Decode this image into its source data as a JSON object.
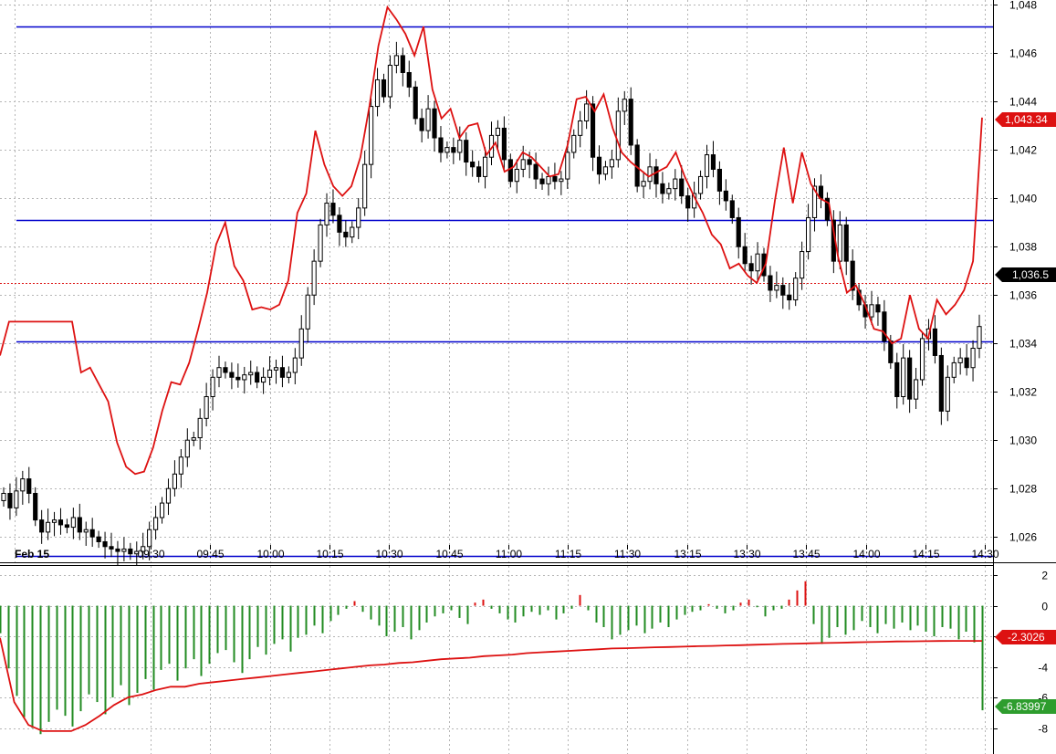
{
  "chart_data": [
    {
      "type": "candlestick",
      "date_label": "Feb 15",
      "x_ticks": [
        "09:30",
        "09:45",
        "10:00",
        "10:15",
        "10:30",
        "10:45",
        "11:00",
        "11:15",
        "11:30",
        "13:15",
        "13:30",
        "13:45",
        "14:00",
        "14:15",
        "14:30"
      ],
      "y_ticks": [
        "1,048",
        "1,046",
        "1,044",
        "1,042",
        "1,040",
        "1,038",
        "1,036",
        "1,034",
        "1,032",
        "1,030",
        "1,028",
        "1,026"
      ],
      "ylim": [
        1024.95,
        1048.2
      ],
      "grid": true,
      "horizontal_lines": [
        1047.1,
        1039.1,
        1034.1,
        1025.2
      ],
      "current_price": 1036.5,
      "current_price_label": "1,036.5",
      "red_line_last_label": "1,043.34",
      "red_line_last_value": 1043.34,
      "colors": {
        "candle": "#000000",
        "red_line": "#dd1111",
        "levels": "#0000cc",
        "badge_black": "#000000",
        "badge_red": "#dd1111"
      },
      "close_series": [
        1027.8,
        1027.2,
        1027.9,
        1028.4,
        1027.8,
        1026.7,
        1026.2,
        1026.6,
        1026.7,
        1026.5,
        1026.4,
        1026.8,
        1026.2,
        1026.3,
        1026.0,
        1025.8,
        1025.6,
        1025.5,
        1025.4,
        1025.5,
        1025.3,
        1025.4,
        1025.6,
        1026.3,
        1026.8,
        1027.4,
        1028.0,
        1028.6,
        1029.3,
        1030.0,
        1030.1,
        1030.9,
        1031.8,
        1032.6,
        1033.0,
        1032.8,
        1032.6,
        1032.5,
        1032.7,
        1032.8,
        1032.4,
        1032.6,
        1032.9,
        1033.0,
        1032.6,
        1032.8,
        1033.4,
        1034.6,
        1036.0,
        1037.4,
        1038.9,
        1039.8,
        1039.3,
        1038.6,
        1038.4,
        1038.8,
        1039.6,
        1041.4,
        1043.8,
        1044.9,
        1044.2,
        1045.5,
        1045.9,
        1045.2,
        1044.6,
        1043.3,
        1042.8,
        1043.7,
        1042.5,
        1041.9,
        1042.1,
        1041.9,
        1042.4,
        1041.5,
        1041.3,
        1040.9,
        1041.7,
        1042.6,
        1042.9,
        1041.6,
        1040.7,
        1041.2,
        1041.6,
        1041.4,
        1040.8,
        1040.6,
        1040.9,
        1040.7,
        1040.8,
        1041.9,
        1042.6,
        1043.2,
        1043.9,
        1041.7,
        1041.0,
        1041.3,
        1041.6,
        1043.6,
        1044.1,
        1042.2,
        1040.5,
        1040.7,
        1041.3,
        1040.6,
        1040.2,
        1040.4,
        1040.8,
        1040.1,
        1039.6,
        1040.2,
        1040.9,
        1041.8,
        1041.2,
        1040.3,
        1039.9,
        1039.2,
        1038.0,
        1037.3,
        1037.0,
        1037.7,
        1036.8,
        1036.2,
        1036.4,
        1036.0,
        1035.8,
        1036.7,
        1037.8,
        1039.2,
        1040.5,
        1040.0,
        1039.1,
        1037.4,
        1038.9,
        1037.4,
        1036.2,
        1035.6,
        1035.1,
        1035.6,
        1035.3,
        1034.1,
        1033.2,
        1031.8,
        1033.4,
        1031.7,
        1032.5,
        1034.2,
        1034.6,
        1033.5,
        1031.2,
        1032.6,
        1033.2,
        1033.4,
        1033.0,
        1033.8,
        1034.7
      ],
      "red_line_series": [
        1033.5,
        1034.9,
        1034.9,
        1034.9,
        1034.9,
        1034.9,
        1034.9,
        1034.9,
        1034.9,
        1032.8,
        1033.0,
        1032.3,
        1031.6,
        1029.9,
        1028.9,
        1028.6,
        1028.7,
        1029.7,
        1031.2,
        1032.4,
        1032.3,
        1033.2,
        1034.6,
        1036.1,
        1038.1,
        1039.0,
        1037.2,
        1036.6,
        1035.4,
        1035.5,
        1035.4,
        1035.6,
        1036.6,
        1039.4,
        1040.2,
        1042.8,
        1041.4,
        1040.5,
        1040.1,
        1040.5,
        1041.7,
        1043.8,
        1046.3,
        1047.9,
        1047.4,
        1046.8,
        1045.9,
        1047.1,
        1044.5,
        1043.3,
        1043.7,
        1042.5,
        1043.0,
        1043.1,
        1041.8,
        1042.3,
        1041.1,
        1041.3,
        1041.9,
        1041.7,
        1041.3,
        1040.9,
        1041.0,
        1042.2,
        1044.1,
        1044.2,
        1043.6,
        1044.3,
        1042.9,
        1041.9,
        1041.5,
        1041.2,
        1040.9,
        1041.1,
        1041.3,
        1041.9,
        1040.9,
        1040.1,
        1039.4,
        1038.5,
        1038.1,
        1037.1,
        1037.3,
        1036.8,
        1036.5,
        1037.3,
        1039.9,
        1042.1,
        1039.8,
        1041.9,
        1040.6,
        1040.0,
        1039.8,
        1037.6,
        1036.1,
        1036.4,
        1035.6,
        1034.6,
        1034.5,
        1034.0,
        1034.2,
        1036.0,
        1034.6,
        1034.2,
        1035.8,
        1035.2,
        1035.6,
        1036.2,
        1037.4,
        1043.34
      ]
    },
    {
      "type": "bar",
      "y_ticks": [
        "2",
        "0",
        "-2",
        "-4",
        "-6",
        "-8"
      ],
      "ylim": [
        -9.7,
        2.6
      ],
      "grid": true,
      "last_value_red_label": "-2.3026",
      "last_value_green_label": "-6.83997",
      "colors": {
        "positive": "#dd1111",
        "negative": "#228B22",
        "signal": "#dd1111"
      },
      "histogram": [
        -1.8,
        -4.1,
        -5.9,
        -7.3,
        -8.0,
        -8.4,
        -7.6,
        -6.8,
        -7.2,
        -7.9,
        -6.9,
        -5.8,
        -6.3,
        -7.1,
        -6.0,
        -5.2,
        -6.5,
        -5.7,
        -4.8,
        -5.5,
        -4.2,
        -3.8,
        -4.9,
        -4.1,
        -3.5,
        -4.6,
        -3.8,
        -3.1,
        -2.9,
        -3.7,
        -4.4,
        -3.5,
        -2.7,
        -3.2,
        -2.5,
        -2.2,
        -3.0,
        -2.1,
        -1.9,
        -1.3,
        -1.8,
        -1.0,
        -0.6,
        -0.2,
        0.3,
        -0.4,
        -0.9,
        -1.3,
        -2.0,
        -1.7,
        -1.4,
        -2.2,
        -1.6,
        -1.1,
        -0.7,
        -0.5,
        -0.3,
        -0.8,
        -1.2,
        0.2,
        0.4,
        -0.2,
        -0.5,
        -0.9,
        -1.1,
        -0.7,
        -0.4,
        -0.6,
        -0.3,
        -0.9,
        -0.5,
        -0.2,
        0.7,
        -0.3,
        -1.1,
        -1.4,
        -2.2,
        -1.9,
        -1.6,
        -1.3,
        -1.8,
        -1.5,
        -1.1,
        -1.4,
        -0.9,
        -0.6,
        -0.4,
        -0.3,
        0.1,
        -0.2,
        -0.5,
        -0.3,
        0.2,
        0.4,
        -0.1,
        -0.7,
        -0.3,
        -0.2,
        0.4,
        1.0,
        1.6,
        -1.2,
        -2.5,
        -2.1,
        -1.4,
        -1.9,
        -1.6,
        -1.0,
        -1.4,
        -1.8,
        -1.2,
        -1.5,
        -1.1,
        -1.6,
        -1.3,
        -1.7,
        -2.0,
        -1.4,
        -1.5,
        -2.2,
        -1.7,
        -2.4,
        -6.84
      ],
      "signal_series": [
        -2.1,
        -6.3,
        -7.8,
        -8.2,
        -8.2,
        -8.2,
        -7.8,
        -7.2,
        -6.5,
        -6.0,
        -5.8,
        -5.5,
        -5.3,
        -5.3,
        -5.1,
        -5.0,
        -4.9,
        -4.8,
        -4.7,
        -4.6,
        -4.5,
        -4.4,
        -4.3,
        -4.2,
        -4.1,
        -4.0,
        -3.9,
        -3.85,
        -3.75,
        -3.7,
        -3.6,
        -3.5,
        -3.45,
        -3.4,
        -3.3,
        -3.25,
        -3.2,
        -3.1,
        -3.05,
        -3.0,
        -2.95,
        -2.9,
        -2.85,
        -2.8,
        -2.78,
        -2.75,
        -2.72,
        -2.7,
        -2.68,
        -2.65,
        -2.63,
        -2.6,
        -2.58,
        -2.55,
        -2.53,
        -2.5,
        -2.48,
        -2.46,
        -2.44,
        -2.42,
        -2.4,
        -2.38,
        -2.36,
        -2.34,
        -2.33,
        -2.32,
        -2.31,
        -2.3,
        -2.3,
        -2.3026
      ]
    }
  ]
}
